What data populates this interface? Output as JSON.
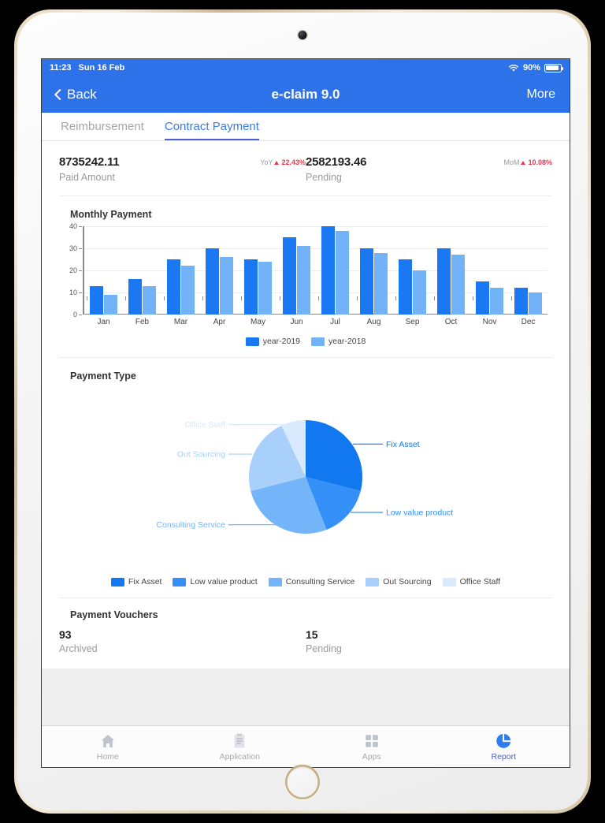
{
  "status_bar": {
    "time": "11:23",
    "date": "Sun 16 Feb",
    "battery_text": "90%",
    "wifi_icon": "wifi-icon",
    "battery_icon": "battery-icon"
  },
  "nav_bar": {
    "back_label": "Back",
    "title": "e-claim 9.0",
    "more_label": "More"
  },
  "tabs": [
    {
      "label": "Reimbursement",
      "active": false
    },
    {
      "label": "Contract Payment",
      "active": true
    }
  ],
  "kpis": [
    {
      "value": "8735242.11",
      "label": "Paid Amount",
      "delta_tag": "YoY",
      "delta_value": "22.43%",
      "direction": "up"
    },
    {
      "value": "2582193.46",
      "label": "Pending",
      "delta_tag": "MoM",
      "delta_value": "10.08%",
      "direction": "up"
    }
  ],
  "sections": {
    "monthly_payment": {
      "title": "Monthly Payment"
    },
    "payment_type": {
      "title": "Payment Type"
    },
    "payment_vouchers": {
      "title": "Payment Vouchers"
    }
  },
  "vouchers": [
    {
      "value": "93",
      "label": "Archived"
    },
    {
      "value": "15",
      "label": "Pending"
    }
  ],
  "tab_bar": [
    {
      "label": "Home",
      "icon": "home-icon",
      "active": false
    },
    {
      "label": "Application",
      "icon": "clipboard-icon",
      "active": false
    },
    {
      "label": "Apps",
      "icon": "grid-icon",
      "active": false
    },
    {
      "label": "Report",
      "icon": "pie-chart-icon",
      "active": true
    }
  ],
  "colors": {
    "brand_blue": "#2d72e8",
    "accent_blue": "#3b7bea",
    "active_tab": "#4b5fd1",
    "delta_red": "#e8384f",
    "series_2019": "#1a79f2",
    "series_2018": "#72b2f7"
  },
  "chart_data": [
    {
      "type": "bar",
      "title": "Monthly Payment",
      "categories": [
        "Jan",
        "Feb",
        "Mar",
        "Apr",
        "May",
        "Jun",
        "Jul",
        "Aug",
        "Sep",
        "Oct",
        "Nov",
        "Dec"
      ],
      "series": [
        {
          "name": "year-2019",
          "color": "#1a79f2",
          "values": [
            13,
            16,
            25,
            30,
            25,
            35,
            40,
            30,
            25,
            30,
            15,
            12
          ]
        },
        {
          "name": "year-2018",
          "color": "#72b2f7",
          "values": [
            9,
            13,
            22,
            26,
            24,
            31,
            38,
            28,
            20,
            27,
            12,
            10
          ]
        }
      ],
      "ylim": [
        0,
        40
      ],
      "yticks": [
        0,
        10,
        20,
        30,
        40
      ],
      "xlabel": "",
      "ylabel": "",
      "grid": true,
      "legend_position": "bottom"
    },
    {
      "type": "pie",
      "title": "Payment Type",
      "labels": [
        "Fix Asset",
        "Low value product",
        "Consulting Service",
        "Out Sourcing",
        "Office Staff"
      ],
      "values": [
        29,
        15,
        27,
        22,
        7
      ],
      "colors": [
        "#1178f0",
        "#3490f7",
        "#74b4f8",
        "#a9d0fb",
        "#d9e9fe"
      ],
      "legend_position": "bottom"
    }
  ]
}
